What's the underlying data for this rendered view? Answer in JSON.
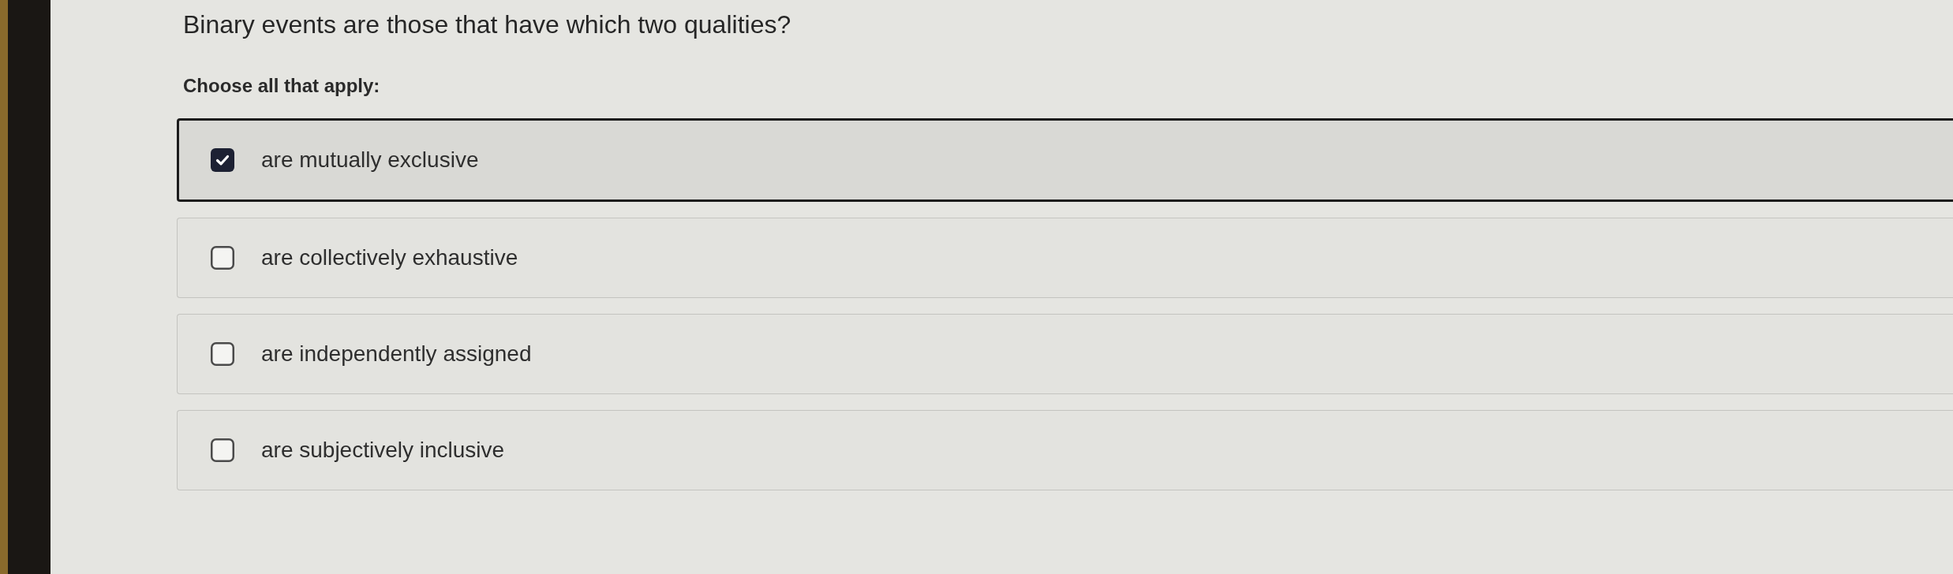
{
  "question": {
    "text": "Binary events are those that have which two qualities?",
    "instruction": "Choose all that apply:"
  },
  "options": [
    {
      "label": "are mutually exclusive",
      "checked": true,
      "selected": true
    },
    {
      "label": "are collectively exhaustive",
      "checked": false,
      "selected": false
    },
    {
      "label": "are independently assigned",
      "checked": false,
      "selected": false
    },
    {
      "label": "are subjectively inclusive",
      "checked": false,
      "selected": false
    }
  ]
}
